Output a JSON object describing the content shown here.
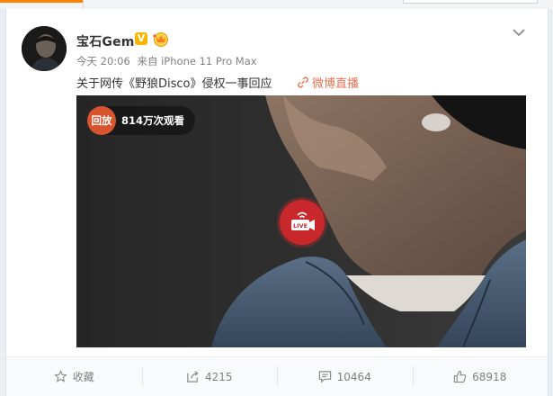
{
  "post": {
    "username": "宝石Gem",
    "verified_badge": "V",
    "time": "今天 20:06",
    "source": "来自 iPhone 11 Pro Max",
    "text": "关于网传《野狼Disco》侵权一事回应",
    "link_text": "微博直播",
    "video": {
      "replay_label": "回放",
      "view_count": "814万次观看",
      "live_label": "LIVE"
    }
  },
  "actions": {
    "favorite": "收藏",
    "repost": "4215",
    "comment": "10464",
    "like": "68918"
  },
  "colors": {
    "accent": "#eb7350",
    "verified": "#f7b500",
    "live_red": "#c8282c",
    "tab_orange": "#ff8200"
  },
  "icons": [
    "star-icon",
    "repost-icon",
    "comment-icon",
    "like-icon",
    "chevron-down-icon",
    "crown-icon",
    "link-icon",
    "live-camera-icon"
  ]
}
